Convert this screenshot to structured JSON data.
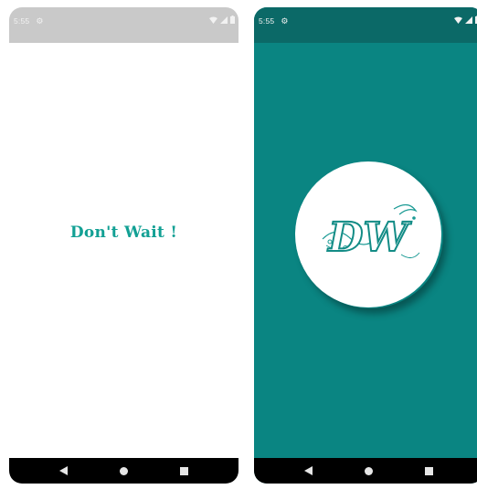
{
  "left_screen": {
    "status_bar": {
      "time": "5:55"
    },
    "headline": "Don't Wait !"
  },
  "right_screen": {
    "status_bar": {
      "time": "5:55"
    },
    "logo": {
      "text": "DW"
    }
  },
  "colors": {
    "teal": "#0a8582",
    "teal_dark": "#0b6967",
    "headline_teal": "#12a094",
    "status_gray": "#c9c9c9"
  },
  "icons": [
    "gear-icon",
    "wifi-icon",
    "signal-icon",
    "battery-icon",
    "back-icon",
    "home-icon",
    "recents-icon"
  ]
}
